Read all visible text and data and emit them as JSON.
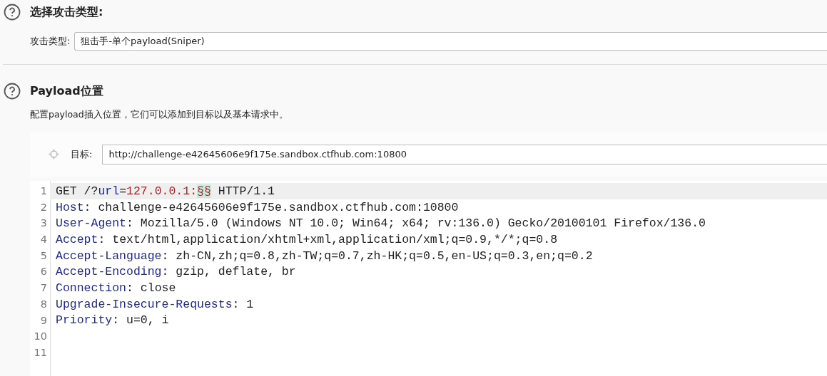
{
  "attack_type_section": {
    "title": "选择攻击类型:",
    "label": "攻击类型:",
    "value": "狙击手-单个payload(Sniper)"
  },
  "positions_section": {
    "title": "Payload位置",
    "description": "配置payload插入位置，它们可以添加到目标以及基本请求中。",
    "target": {
      "label": "目标:",
      "value": "http://challenge-e42645606e9f175e.sandbox.ctfhub.com:10800"
    },
    "editor": {
      "lines": [
        {
          "number": "1",
          "selected": true,
          "segments": [
            {
              "kind": "plain",
              "text": "GET /?"
            },
            {
              "kind": "key",
              "text": "url"
            },
            {
              "kind": "plain",
              "text": "="
            },
            {
              "kind": "value",
              "text": "127.0.0.1:"
            },
            {
              "kind": "marker",
              "text": "§§"
            },
            {
              "kind": "plain",
              "text": " HTTP/1.1"
            }
          ]
        },
        {
          "number": "2",
          "selected": false,
          "segments": [
            {
              "kind": "key",
              "text": "Host"
            },
            {
              "kind": "plain",
              "text": ": challenge-e42645606e9f175e.sandbox.ctfhub.com:10800"
            }
          ]
        },
        {
          "number": "3",
          "selected": false,
          "segments": [
            {
              "kind": "key",
              "text": "User-Agent"
            },
            {
              "kind": "plain",
              "text": ": Mozilla/5.0 (Windows NT 10.0; Win64; x64; rv:136.0) Gecko/20100101 Firefox/136.0"
            }
          ]
        },
        {
          "number": "4",
          "selected": false,
          "segments": [
            {
              "kind": "key",
              "text": "Accept"
            },
            {
              "kind": "plain",
              "text": ": text/html,application/xhtml+xml,application/xml;q=0.9,*/*;q=0.8"
            }
          ]
        },
        {
          "number": "5",
          "selected": false,
          "segments": [
            {
              "kind": "key",
              "text": "Accept-Language"
            },
            {
              "kind": "plain",
              "text": ": zh-CN,zh;q=0.8,zh-TW;q=0.7,zh-HK;q=0.5,en-US;q=0.3,en;q=0.2"
            }
          ]
        },
        {
          "number": "6",
          "selected": false,
          "segments": [
            {
              "kind": "key",
              "text": "Accept-Encoding"
            },
            {
              "kind": "plain",
              "text": ": gzip, deflate, br"
            }
          ]
        },
        {
          "number": "7",
          "selected": false,
          "segments": [
            {
              "kind": "key",
              "text": "Connection"
            },
            {
              "kind": "plain",
              "text": ": close"
            }
          ]
        },
        {
          "number": "8",
          "selected": false,
          "segments": [
            {
              "kind": "key",
              "text": "Upgrade-Insecure-Requests"
            },
            {
              "kind": "plain",
              "text": ": 1"
            }
          ]
        },
        {
          "number": "9",
          "selected": false,
          "segments": [
            {
              "kind": "key",
              "text": "Priority"
            },
            {
              "kind": "plain",
              "text": ": u=0, i"
            }
          ]
        },
        {
          "number": "10",
          "selected": false
        },
        {
          "number": "11",
          "selected": false
        }
      ]
    }
  }
}
